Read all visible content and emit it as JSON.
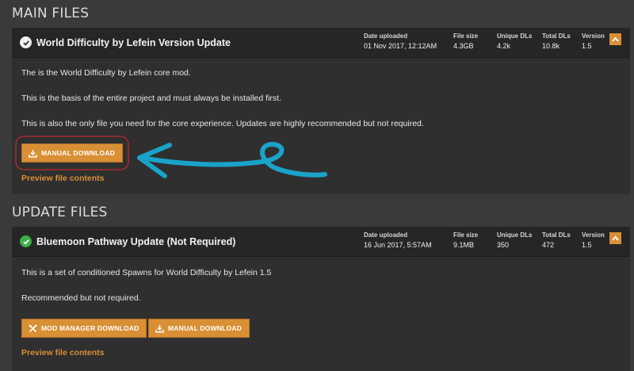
{
  "sections": {
    "main": "MAIN FILES",
    "update": "UPDATE FILES"
  },
  "stat_labels": {
    "date": "Date uploaded",
    "size": "File size",
    "unique": "Unique DLs",
    "total": "Total DLs",
    "version": "Version"
  },
  "main_file": {
    "name": "World Difficulty by Lefein Version Update",
    "date": "01 Nov 2017, 12:12AM",
    "size": "4.3GB",
    "unique_dls": "4.2k",
    "total_dls": "10.8k",
    "version": "1.5",
    "desc1": "The is the World Difficulty by Lefein core mod.",
    "desc2": "This is the basis of the entire project and must always be installed first.",
    "desc3": "This is also the only file you need for the core experience. Updates are highly recommended but not required.",
    "manual_download": "MANUAL DOWNLOAD",
    "preview": "Preview file contents"
  },
  "update_file": {
    "name": "Bluemoon Pathway Update (Not Required)",
    "date": "16 Jun 2017, 5:57AM",
    "size": "9.1MB",
    "unique_dls": "350",
    "total_dls": "472",
    "version": "1.5",
    "desc1": "This is a set of conditioned Spawns for World Difficulty by Lefein 1.5",
    "desc2": "Recommended but not required.",
    "mod_manager_download": "MOD MANAGER DOWNLOAD",
    "manual_download": "MANUAL DOWNLOAD",
    "preview": "Preview file contents"
  },
  "colors": {
    "accent": "#d98f34",
    "annotation_arrow": "#1aa3c8",
    "annotation_circle": "#c22a2a",
    "check_green": "#3fae49"
  },
  "icons": {
    "check": "check-icon",
    "collapse": "chevron-up-icon",
    "download": "download-icon",
    "mod_manager": "wrench-icon"
  }
}
